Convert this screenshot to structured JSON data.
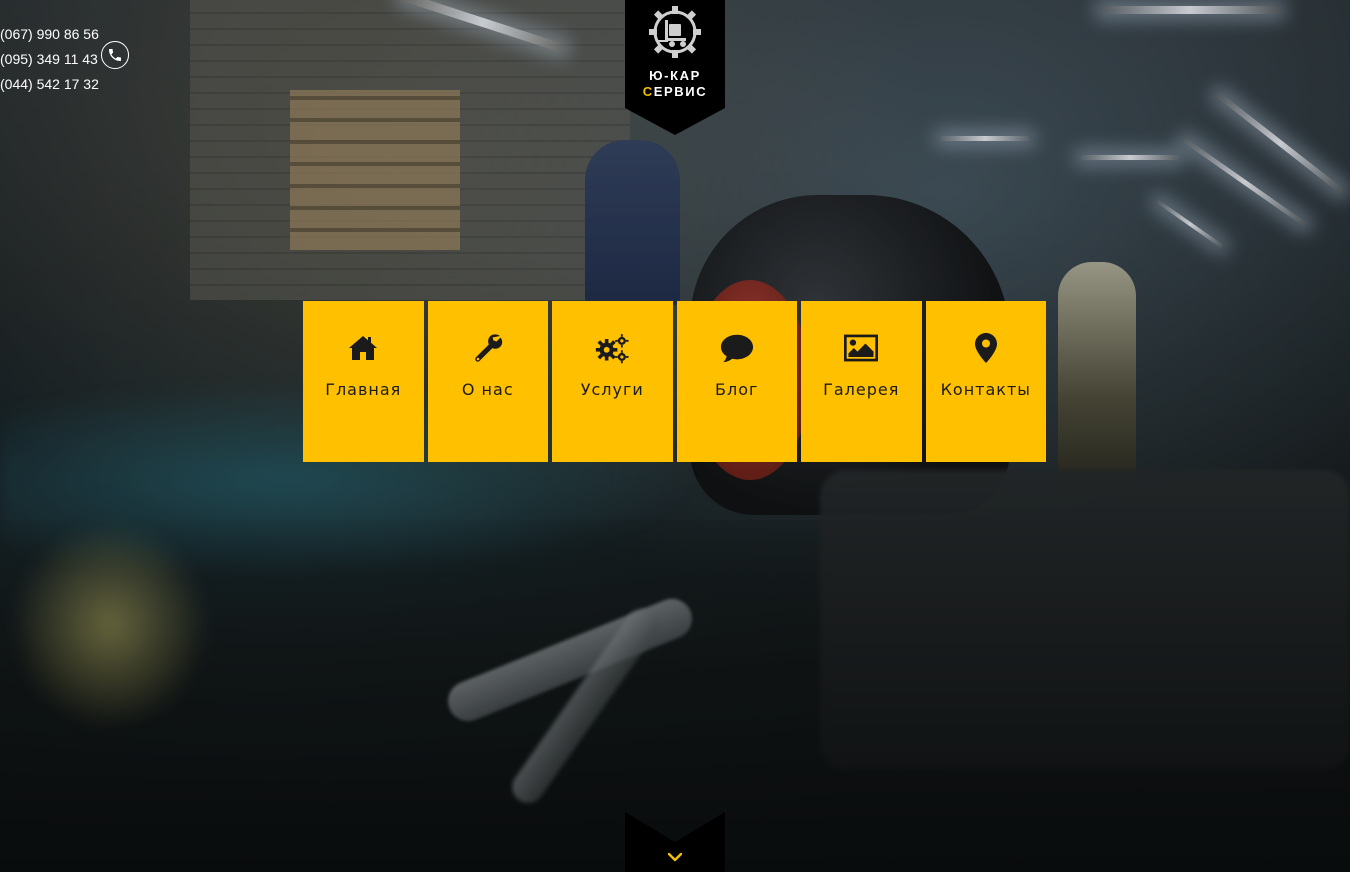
{
  "phones": {
    "items": [
      "(067) 990 86 56",
      "(095) 349 11 43",
      "(044) 542 17 32"
    ],
    "icon": "phone-icon"
  },
  "logo": {
    "line1_part1": "Ю-",
    "line1_part2": "КАР",
    "line2_part1": "С",
    "line2_part2": "ЕРВИС",
    "icon": "gear-forklift-icon"
  },
  "nav": {
    "items": [
      {
        "label": "Главная",
        "icon": "home-icon"
      },
      {
        "label": "О нас",
        "icon": "wrench-icon"
      },
      {
        "label": "Услуги",
        "icon": "gears-icon"
      },
      {
        "label": "Блог",
        "icon": "comment-icon"
      },
      {
        "label": "Галерея",
        "icon": "picture-icon"
      },
      {
        "label": "Контакты",
        "icon": "map-marker-icon"
      }
    ]
  },
  "scroll": {
    "icon": "chevron-down-icon"
  },
  "colors": {
    "accent": "#ffc000",
    "badge": "#000000",
    "text_light": "#ffffff",
    "text_dark": "#1b1b1b"
  }
}
